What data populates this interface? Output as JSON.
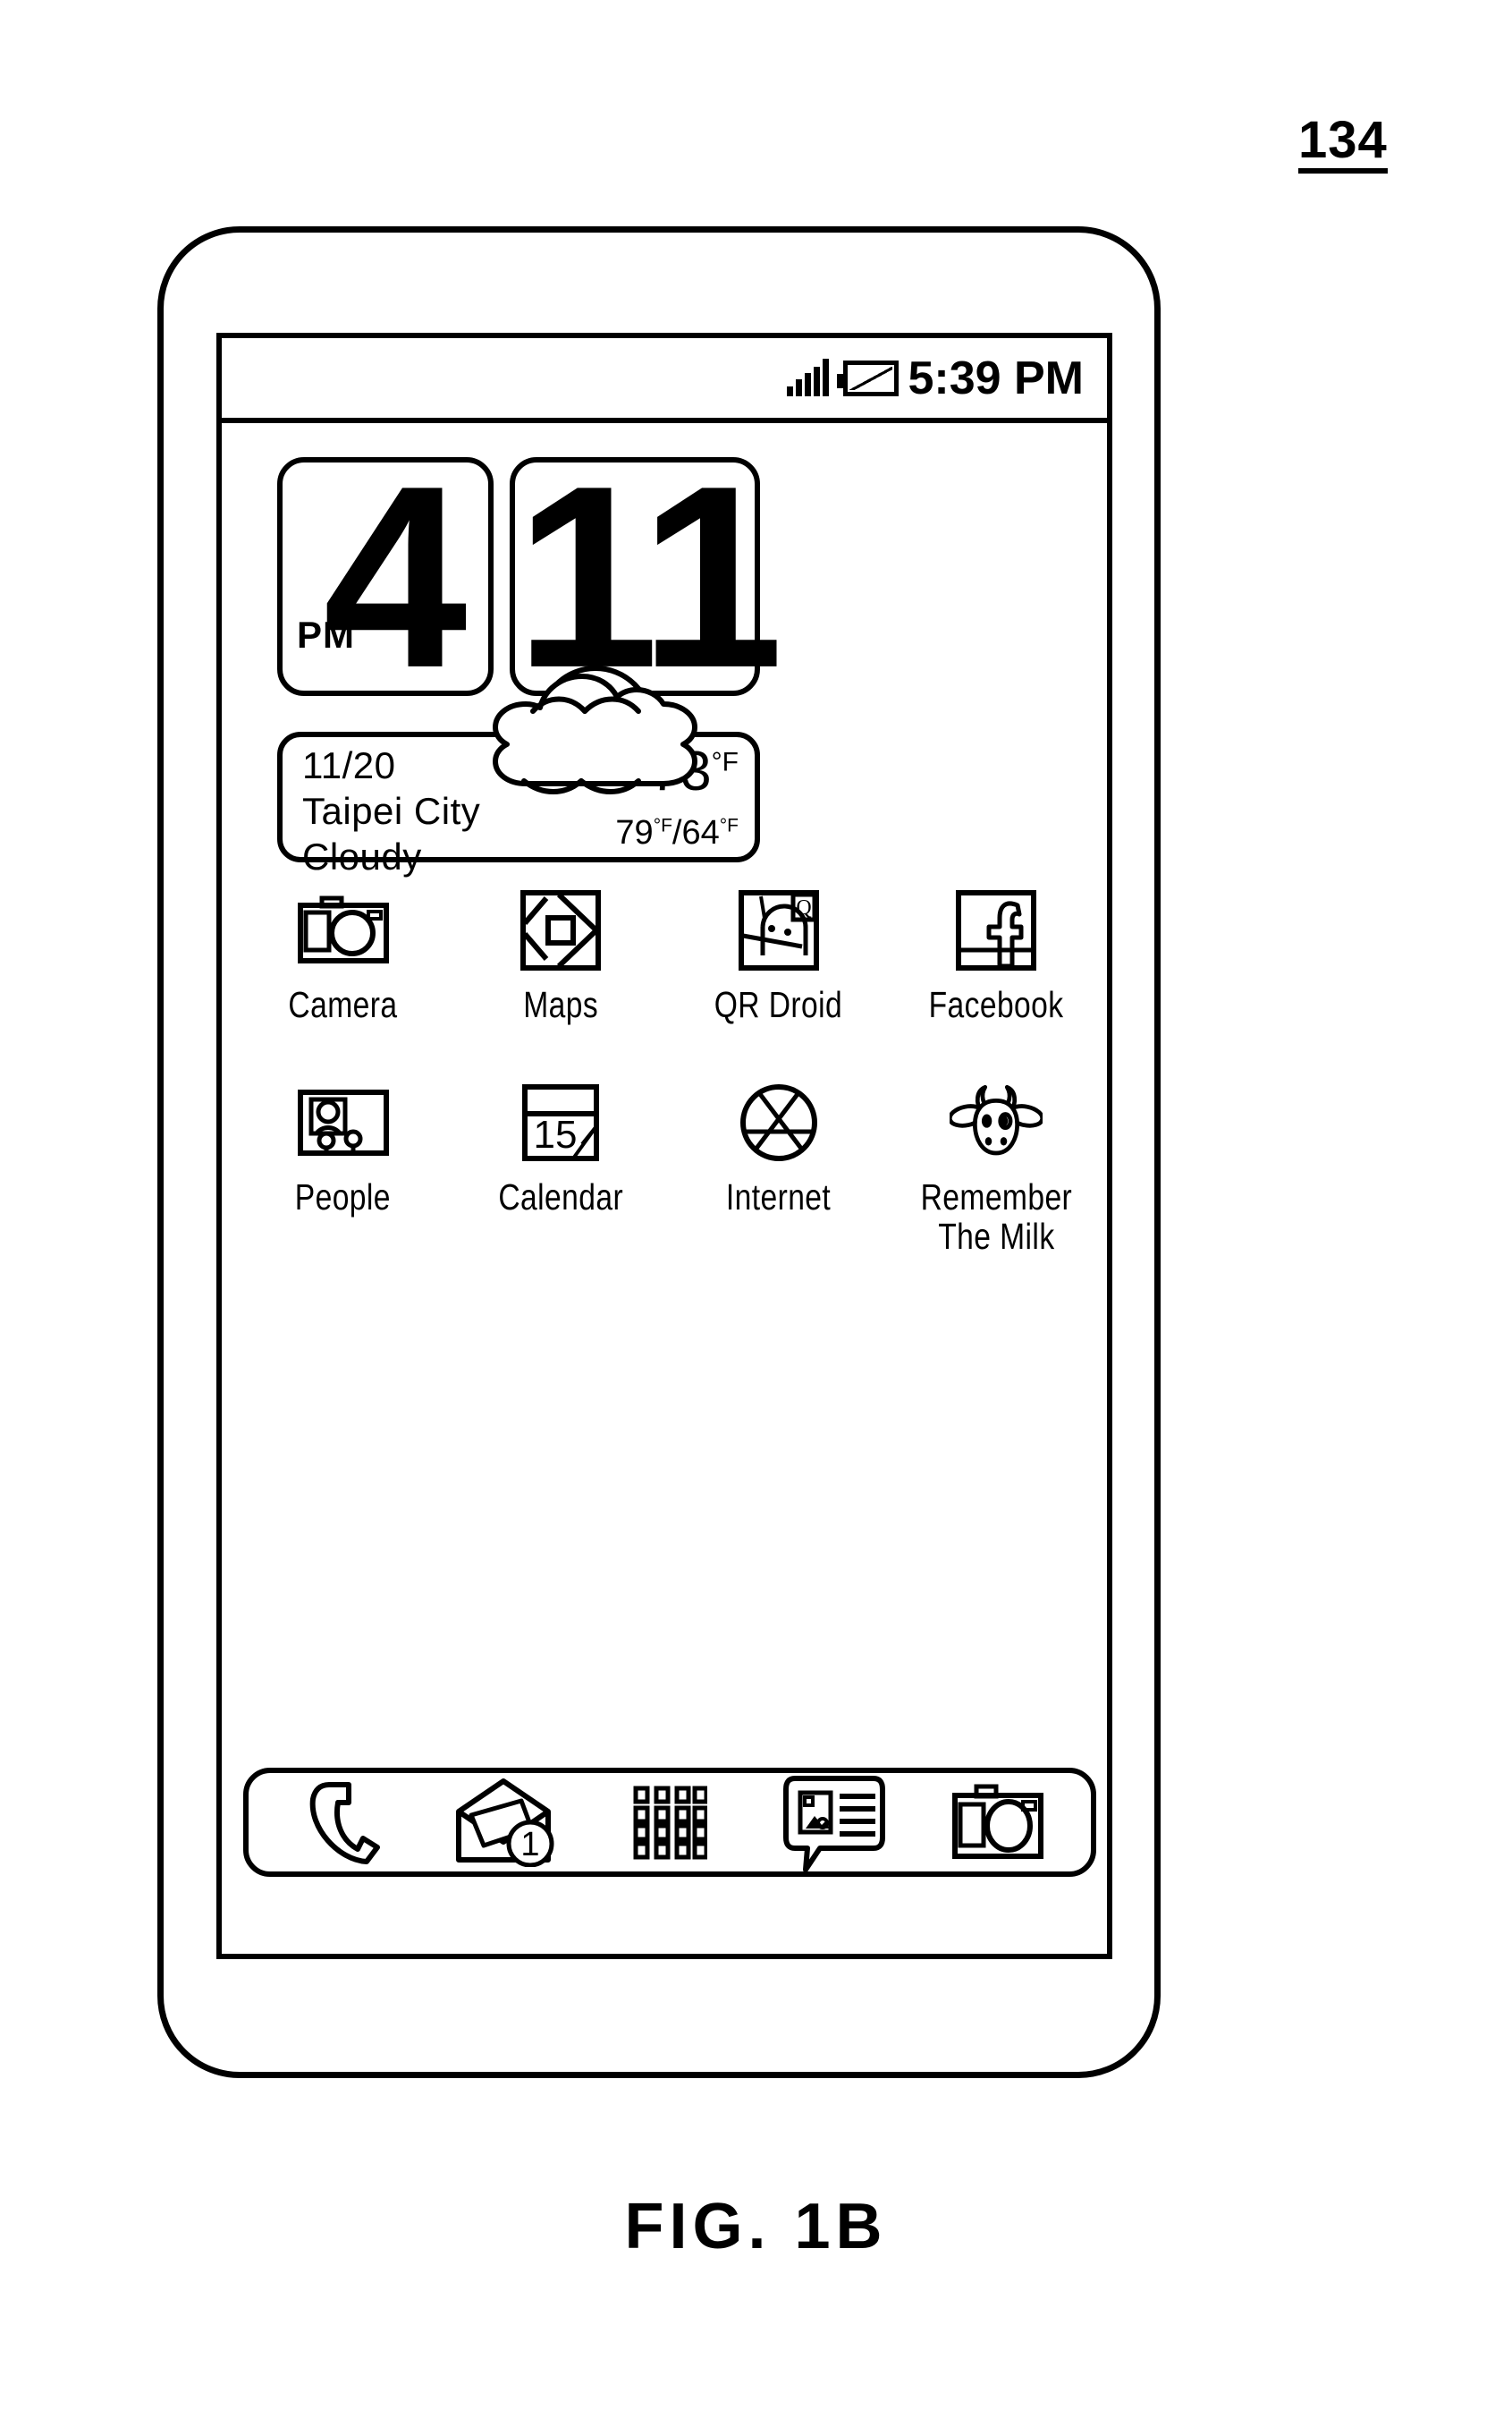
{
  "figure": {
    "reference_numeral": "134",
    "caption": "FIG. 1B"
  },
  "status_bar": {
    "signal_icon": "signal-bars-icon",
    "battery_icon": "battery-icon",
    "time": "5:39 PM"
  },
  "clock_widget": {
    "hour": "4",
    "ampm": "PM",
    "minute": "11",
    "weather_glyph": "cloud-sun-icon"
  },
  "weather": {
    "date": "11/20",
    "location": "Taipei City",
    "condition": "Cloudy",
    "temperature": "73",
    "temperature_unit": "°F",
    "high": "79",
    "high_unit": "°F",
    "separator": "/",
    "low": "64",
    "low_unit": "°F"
  },
  "apps": {
    "row1": [
      {
        "label": "Camera",
        "icon": "camera-icon"
      },
      {
        "label": "Maps",
        "icon": "maps-icon"
      },
      {
        "label": "QR Droid",
        "icon": "qr-droid-icon"
      },
      {
        "label": "Facebook",
        "icon": "facebook-icon"
      }
    ],
    "row2": [
      {
        "label": "People",
        "icon": "people-icon"
      },
      {
        "label": "Calendar",
        "icon": "calendar-icon",
        "day": "15"
      },
      {
        "label": "Internet",
        "icon": "globe-icon"
      },
      {
        "label": "Remember\nThe Milk",
        "icon": "cow-icon"
      }
    ]
  },
  "dock": {
    "items": [
      {
        "name": "phone",
        "icon": "phone-handset-icon"
      },
      {
        "name": "mail",
        "icon": "envelope-icon",
        "badge": "1"
      },
      {
        "name": "all-apps",
        "icon": "app-grid-icon"
      },
      {
        "name": "messages",
        "icon": "message-bubble-icon"
      },
      {
        "name": "camera",
        "icon": "camera-icon"
      }
    ]
  },
  "colors": {
    "line": "#000000",
    "background": "#ffffff"
  }
}
